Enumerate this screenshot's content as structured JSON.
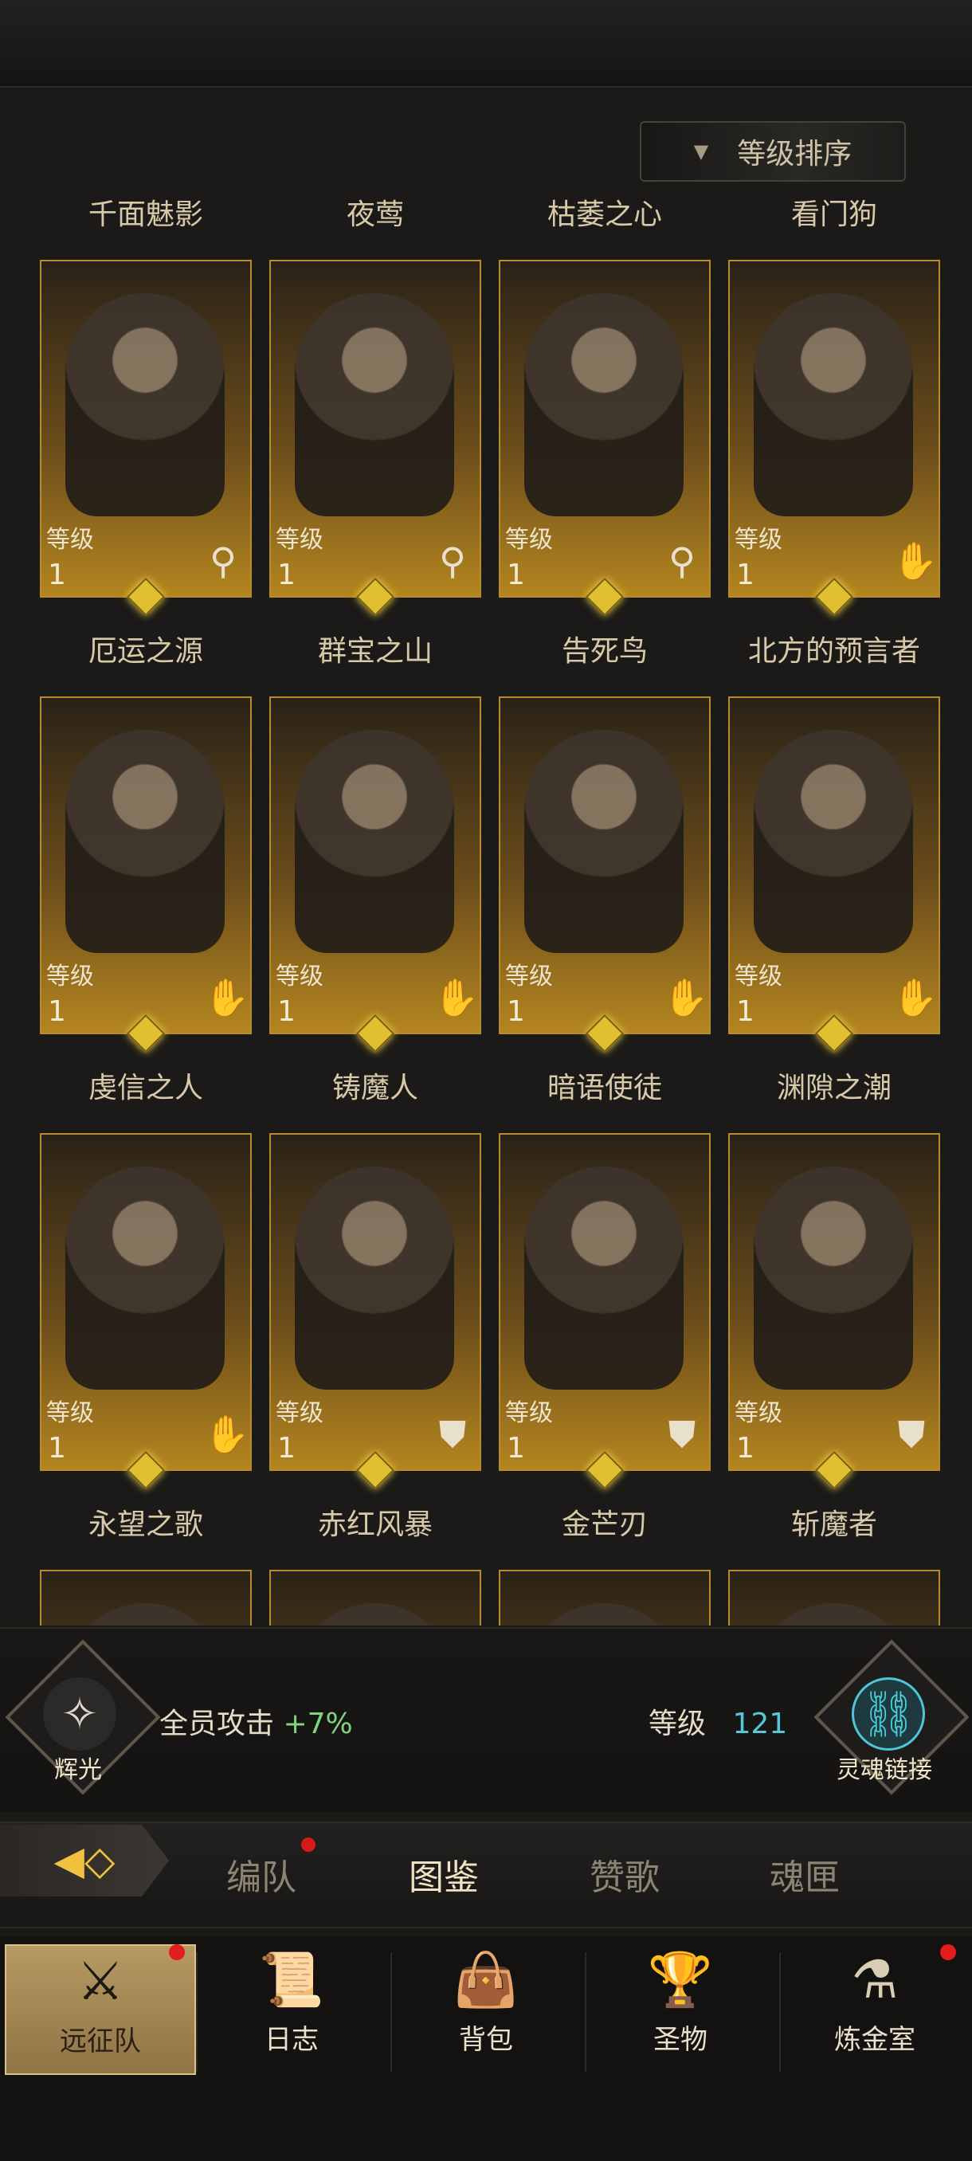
{
  "sort_button": {
    "label": "等级排序",
    "icon": "triangle-down-icon"
  },
  "level_label": "等级",
  "heroes": [
    {
      "name": "千面魅影",
      "level": "1",
      "role_icon": "staff-icon"
    },
    {
      "name": "夜莺",
      "level": "1",
      "role_icon": "staff-icon"
    },
    {
      "name": "枯萎之心",
      "level": "1",
      "role_icon": "staff-icon"
    },
    {
      "name": "看门狗",
      "level": "1",
      "role_icon": "hand-icon"
    },
    {
      "name": "厄运之源",
      "level": "1",
      "role_icon": "hand-icon"
    },
    {
      "name": "群宝之山",
      "level": "1",
      "role_icon": "hand-icon"
    },
    {
      "name": "告死鸟",
      "level": "1",
      "role_icon": "hand-icon"
    },
    {
      "name": "北方的预言者",
      "level": "1",
      "role_icon": "hand-icon"
    },
    {
      "name": "虔信之人",
      "level": "1",
      "role_icon": "hand-icon"
    },
    {
      "name": "铸魔人",
      "level": "1",
      "role_icon": "shield-icon"
    },
    {
      "name": "暗语使徒",
      "level": "1",
      "role_icon": "shield-icon"
    },
    {
      "name": "渊隙之潮",
      "level": "1",
      "role_icon": "shield-icon"
    },
    {
      "name": "永望之歌",
      "level": "",
      "role_icon": ""
    },
    {
      "name": "赤红风暴",
      "level": "",
      "role_icon": ""
    },
    {
      "name": "金芒刃",
      "level": "",
      "role_icon": ""
    },
    {
      "name": "斩魔者",
      "level": "",
      "role_icon": ""
    }
  ],
  "bonus": {
    "radiance_label": "辉光",
    "attack_text": "全员攻击",
    "attack_value": "+7%",
    "level_text": "等级",
    "level_value": "121",
    "soul_link_label": "灵魂链接"
  },
  "tabs": {
    "items": [
      "编队",
      "图鉴",
      "赞歌",
      "魂匣"
    ],
    "active": "图鉴"
  },
  "nav": {
    "items": [
      {
        "label": "远征队",
        "icon": "viking-helmet-icon"
      },
      {
        "label": "日志",
        "icon": "scroll-icon"
      },
      {
        "label": "背包",
        "icon": "bag-icon"
      },
      {
        "label": "圣物",
        "icon": "chalice-icon"
      },
      {
        "label": "炼金室",
        "icon": "alchemy-icon"
      }
    ],
    "active": "远征队"
  },
  "colors": {
    "gold": "#b78a2a",
    "notification": "#d61a1a",
    "green_stat": "#7fd47c",
    "cyan_stat": "#55c8d8"
  }
}
